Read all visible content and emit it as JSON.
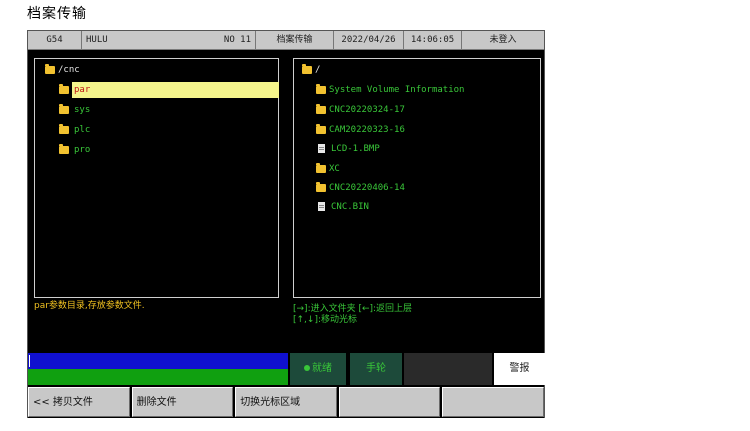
{
  "page_title": "档案传输",
  "status_bar": {
    "mode": "G54",
    "user": "HULU",
    "program_no": "NO 11",
    "function": "档案传输",
    "date": "2022/04/26",
    "time": "14:06:05",
    "login": "未登入"
  },
  "left_panel": {
    "root": "/cnc",
    "items": [
      {
        "label": "par",
        "type": "folder",
        "selected": true
      },
      {
        "label": "sys",
        "type": "folder",
        "selected": false
      },
      {
        "label": "plc",
        "type": "folder",
        "selected": false
      },
      {
        "label": "pro",
        "type": "folder",
        "selected": false
      }
    ]
  },
  "right_panel": {
    "root": "/",
    "items": [
      {
        "label": "System Volume Information",
        "type": "folder"
      },
      {
        "label": "CNC20220324-17",
        "type": "folder"
      },
      {
        "label": "CAM20220323-16",
        "type": "folder"
      },
      {
        "label": "LCD-1.BMP",
        "type": "file"
      },
      {
        "label": "XC",
        "type": "folder"
      },
      {
        "label": "CNC20220406-14",
        "type": "folder"
      },
      {
        "label": "CNC.BIN",
        "type": "file"
      }
    ]
  },
  "hints": {
    "left": "par参数目录,存放参数文件.",
    "right_line1": "[→]:进入文件夹 [←]:返回上层",
    "right_line2": "[↑,↓]:移动光标"
  },
  "status_indicators": {
    "ready": "就绪",
    "mode": "手轮",
    "alarm": "警报"
  },
  "softkeys": [
    "<< 拷贝文件",
    "删除文件",
    "切换光标区域",
    "",
    ""
  ],
  "colors": {
    "selected_bg": "#f5f58c",
    "selected_text": "#c01818",
    "accent_green": "#39c639",
    "folder": "#f2c230"
  }
}
